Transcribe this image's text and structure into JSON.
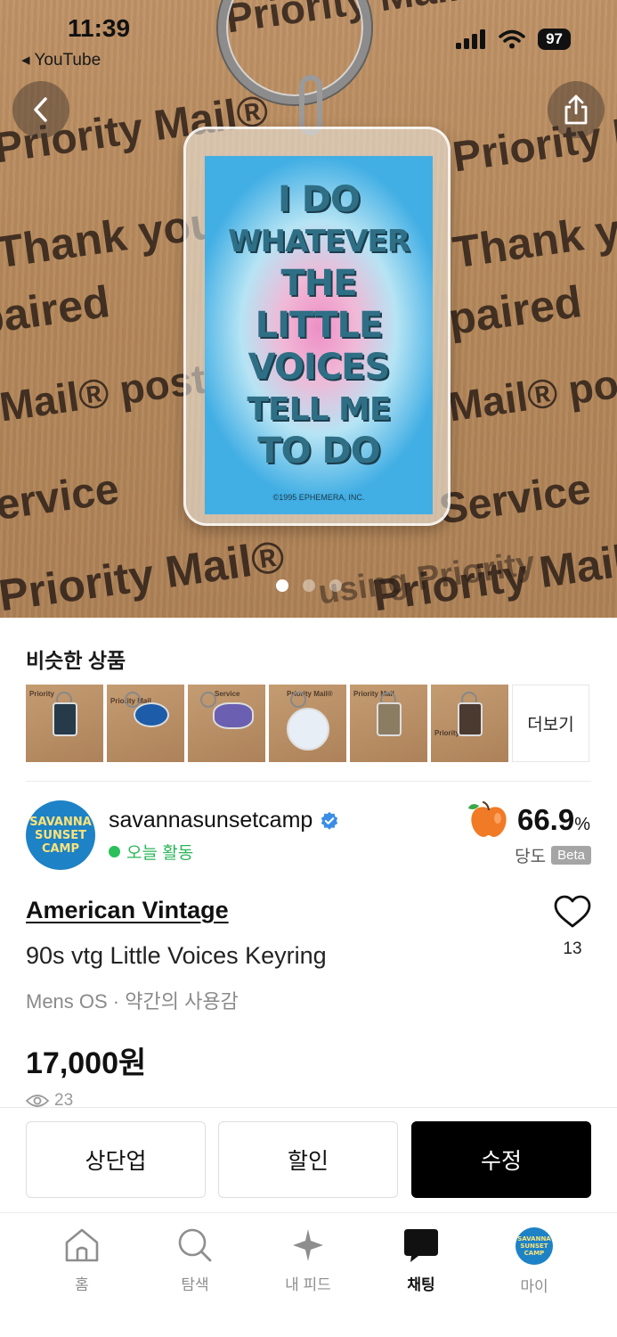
{
  "status_bar": {
    "time": "11:39",
    "back_app": "◂ YouTube",
    "battery": "97"
  },
  "hero": {
    "background_print": [
      "Priority Mail® Service",
      "Thank you",
      "paired",
      "Mail® postage",
      "Service",
      "Priority Mail®",
      "using Priority"
    ],
    "keyring_card_text": [
      "I DO",
      "WHATEVER",
      "THE",
      "LITTLE",
      "VOICES",
      "TELL ME",
      "TO DO"
    ],
    "keyring_copyright": "©1995 EPHEMERA, INC.",
    "page_count": 3,
    "current_page": 1
  },
  "similar": {
    "title": "비슷한 상품",
    "more_label": "더보기",
    "item_count": 6
  },
  "seller": {
    "avatar_text": [
      "SAVANNA",
      "SUNSET",
      "CAMP"
    ],
    "name": "savannasunsetcamp",
    "activity": "오늘 활동",
    "score_value": "66.9",
    "score_unit": "%",
    "score_label": "당도",
    "score_badge": "Beta"
  },
  "product": {
    "brand": "American Vintage",
    "title": "90s vtg Little Voices Keyring",
    "meta": "Mens OS · 약간의 사용감",
    "price": "17,000원",
    "views": "23",
    "likes": "13"
  },
  "actions": {
    "bump_label": "상단업",
    "discount_label": "할인",
    "edit_label": "수정"
  },
  "nav": {
    "items": [
      {
        "label": "홈",
        "icon": "home-icon"
      },
      {
        "label": "탐색",
        "icon": "search-icon"
      },
      {
        "label": "내 피드",
        "icon": "sparkle-icon"
      },
      {
        "label": "채팅",
        "icon": "chat-icon"
      },
      {
        "label": "마이",
        "icon": "avatar"
      }
    ],
    "active_index": 3
  },
  "colors": {
    "accent_green": "#2cc05a",
    "verified_blue": "#3a8ee6",
    "primary_button": "#000000"
  }
}
